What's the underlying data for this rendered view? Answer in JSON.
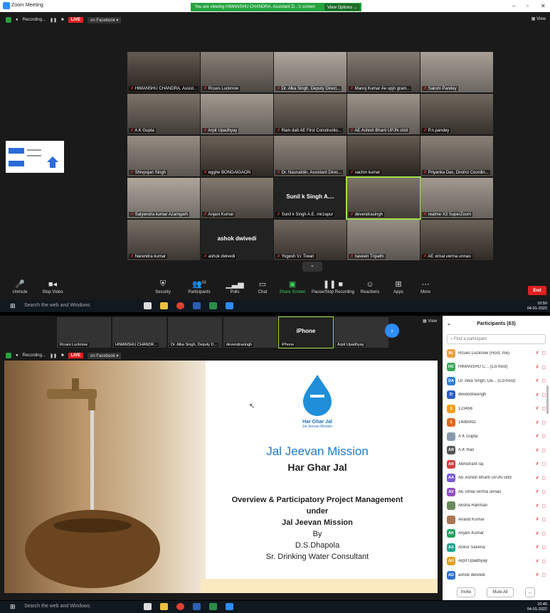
{
  "w1": {
    "app_title": "Zoom Meeting",
    "banner": "You are viewing HIMANSHU CHANDRA, Assistant D...'s screen",
    "view_options": "View Options ⌄",
    "recording": "Recording...",
    "live": "LIVE",
    "on_facebook": "on Facebook ▾",
    "view": "View",
    "tiles": [
      "HIMANSHU CHANDRA, Assist...",
      "Rcues Lucknow",
      "Dr. Alka Singh, Deputy Direct...",
      "Manoj Kumar  Ae  upjn  gram...",
      "Sakshi Pandey",
      "A K Gupta",
      "Arpit Upadhyay",
      "Ram datt AE First Constructio...",
      "AE  Ashish Bharti UPJN cktd",
      "P.n.pandey",
      "Shivpujan Singh",
      "egghe BONGAIGAON",
      "Dr. Nasruddin, Assistant Direc...",
      "sachin kumar",
      "Priyanka Das, District Coordin...",
      "Satyendra kumar Azamgarh",
      "Anjani Kumar",
      "Sunil k Singh A.E. mirzapur",
      "devendrasingh",
      "realme X3 SuperZoom",
      "Narendra kumar",
      "ashok dwivedi",
      "Yogesh V.r Tiwari",
      "naveen Tripathi",
      "AE vimal verma unnao"
    ],
    "tile_text": {
      "sunil": "Sunil k Singh A....",
      "ashok": "ashok dwivedi"
    },
    "toolbar": {
      "unmute": "Unmute",
      "stop_video": "Stop Video",
      "security": "Security",
      "participants": "Participants",
      "participants_count": "63",
      "polls": "Polls",
      "chat": "Chat",
      "share_screen": "Share Screen",
      "pause_recording": "Pause/Stop Recording",
      "reactions": "Reactions",
      "apps": "Apps",
      "more": "More",
      "end": "End"
    },
    "taskbar": {
      "search": "Search the web and Windows",
      "time": "10:50",
      "date": "04-01-2022"
    }
  },
  "w2": {
    "strip": [
      "Rcues Lucknow",
      "HIMANSHU CHANDR...",
      "Dr. Alka Singh, Deputy D...",
      "devendrasingh",
      "iPhone",
      "Arpit Upadhyay"
    ],
    "iphone_center": "iPhone",
    "view": "View",
    "recording": "Recording...",
    "live": "LIVE",
    "on_facebook": "on Facebook ▾",
    "slide": {
      "logo_line1": "Har Ghar Jal",
      "logo_line2": "Jal Jeevan Mission",
      "title": "Jal Jeevan Mission",
      "subtitle": "Har Ghar Jal",
      "body": [
        "Overview & Participatory Project Management",
        "under",
        "Jal Jeevan Mission",
        "By",
        "D.S.Dhapola",
        "Sr. Drinking Water Consultant"
      ]
    },
    "panel": {
      "title": "Participants (63)",
      "find": "Find a participant",
      "people": [
        {
          "initials": "RL",
          "name": "Rcues Lucknow (Host, me)",
          "color": "#e8a23a"
        },
        {
          "initials": "HC",
          "name": "HIMANSHU C... (Co-host)",
          "color": "#3aa856"
        },
        {
          "initials": "DA",
          "name": "Dr. Alka Singh, De... (Co-host)",
          "color": "#2d7fd6"
        },
        {
          "initials": "D",
          "name": "devendrasingh",
          "color": "#2f5fc4"
        },
        {
          "initials": "1",
          "name": "123456",
          "color": "#f0a020"
        },
        {
          "initials": "1",
          "name": "14dd5fd2",
          "color": "#e06a20"
        },
        {
          "initials": "",
          "name": "A K Gupta",
          "color": "#8899aa"
        },
        {
          "initials": "AR",
          "name": "A.K Rao",
          "color": "#555555"
        },
        {
          "initials": "AR",
          "name": "Abhishant raj",
          "color": "#d04040"
        },
        {
          "initials": "AA",
          "name": "AE  Ashish Bharti UPJN cktd",
          "color": "#7a5ad0"
        },
        {
          "initials": "AV",
          "name": "AE vimal verma unnao",
          "color": "#9050c0"
        },
        {
          "initials": "",
          "name": "Aksha Rahman",
          "color": "#6a8a5a"
        },
        {
          "initials": "",
          "name": "Anand Kumar",
          "color": "#aa7755"
        },
        {
          "initials": "AK",
          "name": "Anjani Kumar",
          "color": "#2aa060"
        },
        {
          "initials": "AS",
          "name": "Ankur Saxena",
          "color": "#20a090"
        },
        {
          "initials": "AU",
          "name": "Arpit Upadhyay",
          "color": "#e0a020"
        },
        {
          "initials": "AD",
          "name": "ashok dwivedi",
          "color": "#3070d0"
        }
      ],
      "invite": "Invite",
      "mute_all": "Mute All",
      "more": "..."
    },
    "taskbar": {
      "search": "Search the web and Windows",
      "time": "10:45",
      "date": "04-01-2022"
    }
  }
}
